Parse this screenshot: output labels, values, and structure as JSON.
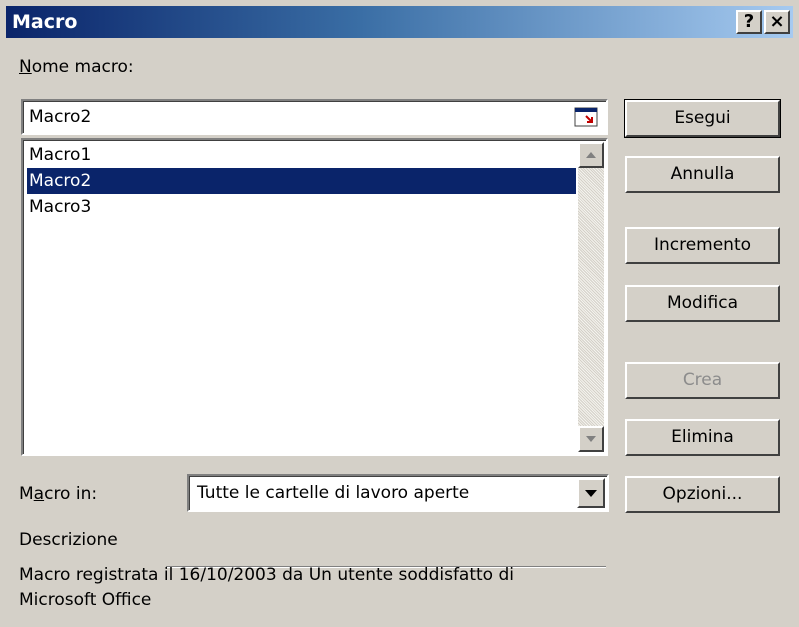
{
  "window": {
    "title": "Macro",
    "help_label": "?",
    "close_label": "×"
  },
  "macro_name": {
    "label": "Nome macro:",
    "value": "Macro2"
  },
  "macro_list": {
    "items": [
      "Macro1",
      "Macro2",
      "Macro3"
    ],
    "selected_index": 1
  },
  "macro_in": {
    "label": "Macro in:",
    "value": "Tutte le cartelle di lavoro aperte"
  },
  "description": {
    "label": "Descrizione",
    "text_line1": "Macro registrata il 16/10/2003 da Un utente soddisfatto di",
    "text_line2": "Microsoft Office"
  },
  "buttons": {
    "run": "Esegui",
    "cancel": "Annulla",
    "step_into": "Incremento",
    "edit": "Modifica",
    "create": "Crea",
    "delete": "Elimina",
    "options": "Opzioni..."
  },
  "colors": {
    "title_start": "#0a246a",
    "title_end": "#a6caf0",
    "selection": "#0a246a",
    "dialog_bg": "#d4d0c8"
  }
}
